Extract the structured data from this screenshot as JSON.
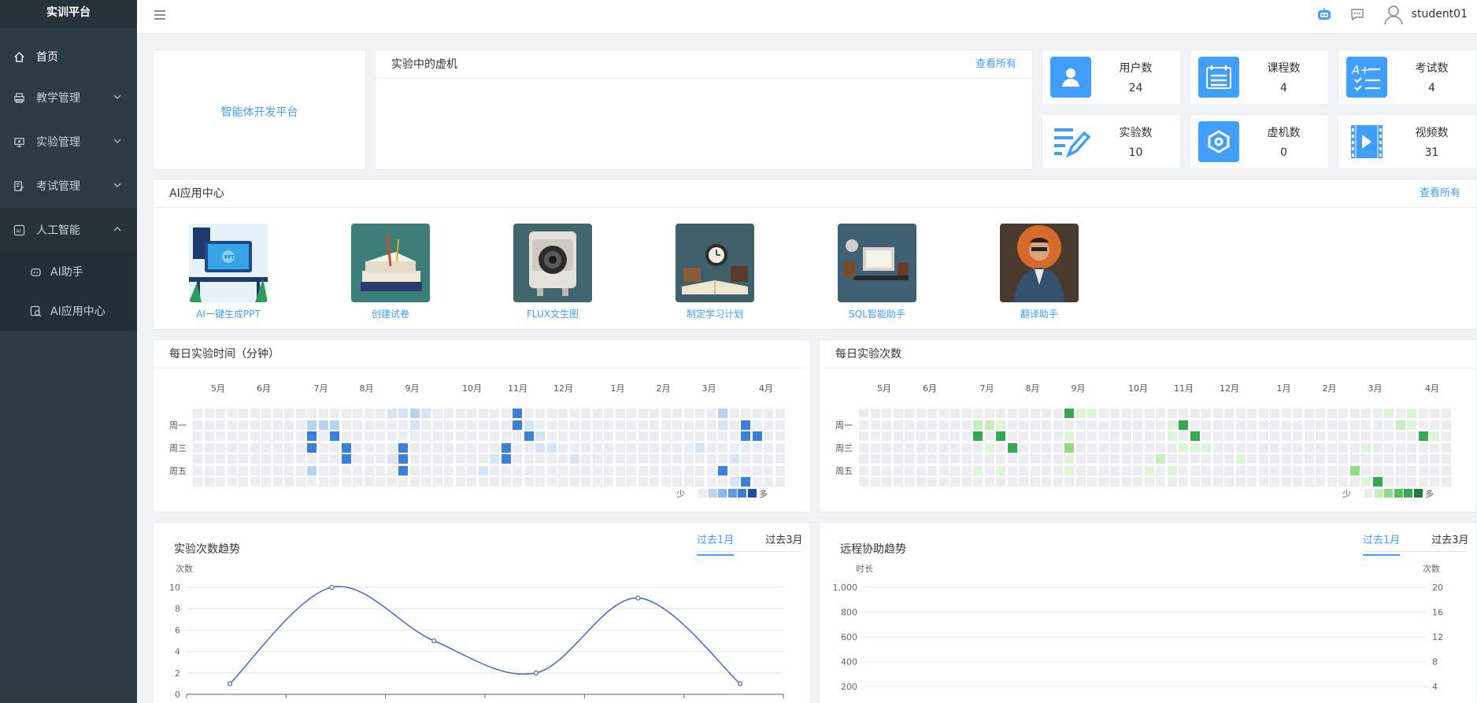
{
  "sidebar": {
    "logo": "实训平台",
    "items": [
      {
        "label": "首页"
      },
      {
        "label": "教学管理"
      },
      {
        "label": "实验管理"
      },
      {
        "label": "考试管理"
      },
      {
        "label": "人工智能"
      }
    ],
    "sub_items": [
      {
        "label": "AI助手"
      },
      {
        "label": "AI应用中心"
      }
    ]
  },
  "header": {
    "username": "student01"
  },
  "brand": {
    "link": "智能体开发平台"
  },
  "vm_panel": {
    "title": "实验中的虚机",
    "link": "查看所有"
  },
  "stats": [
    {
      "label": "用户数",
      "value": "24",
      "icon": "user-icon"
    },
    {
      "label": "课程数",
      "value": "4",
      "icon": "calendar-list-icon"
    },
    {
      "label": "考试数",
      "value": "4",
      "icon": "grade-checklist-icon"
    },
    {
      "label": "实验数",
      "value": "10",
      "icon": "edit-document-icon"
    },
    {
      "label": "虚机数",
      "value": "0",
      "icon": "hexagon-icon"
    },
    {
      "label": "视频数",
      "value": "31",
      "icon": "video-film-icon"
    }
  ],
  "ai_center": {
    "title": "AI应用中心",
    "link": "查看所有",
    "apps": [
      {
        "label": "AI一键生成PPT"
      },
      {
        "label": "创建试卷"
      },
      {
        "label": "FLUX文生图"
      },
      {
        "label": "制定学习计划"
      },
      {
        "label": "SQL智能助手"
      },
      {
        "label": "翻译助手"
      }
    ]
  },
  "heatmap_time": {
    "title": "每日实验时间（分钟）",
    "months": [
      "5月",
      "6月",
      "7月",
      "8月",
      "9月",
      "10月",
      "11月",
      "12月",
      "1月",
      "2月",
      "3月",
      "4月"
    ],
    "days": [
      "周一",
      "周三",
      "周五"
    ],
    "legend_less": "少",
    "legend_more": "多",
    "colors": [
      "#ebedf0",
      "#d6e4f7",
      "#b8d3f2",
      "#8ab8ec",
      "#5b9be2",
      "#3a7fd9",
      "#1f4e9e"
    ]
  },
  "heatmap_count": {
    "title": "每日实验次数",
    "months": [
      "5月",
      "6月",
      "7月",
      "8月",
      "9月",
      "10月",
      "11月",
      "12月",
      "1月",
      "2月",
      "3月",
      "4月"
    ],
    "days": [
      "周一",
      "周三",
      "周五"
    ],
    "legend_less": "少",
    "legend_more": "多",
    "colors": [
      "#ebedf0",
      "#dff5d9",
      "#c6ecbd",
      "#8fdc84",
      "#52c15d",
      "#34a853",
      "#1f7a3a"
    ]
  },
  "trend_count": {
    "title": "实验次数趋势",
    "tabs": [
      "过去1月",
      "过去3月"
    ],
    "ylabel": "次数",
    "yticks": [
      "10",
      "8",
      "6",
      "4",
      "2",
      "0"
    ]
  },
  "trend_remote": {
    "title": "远程协助趋势",
    "tabs": [
      "过去1月",
      "过去3月"
    ],
    "ylabel_left": "时长",
    "ylabel_right": "次数",
    "yticks_left": [
      "1,000",
      "800",
      "600",
      "400",
      "200"
    ],
    "yticks_right": [
      "20",
      "16",
      "12",
      "8",
      "4"
    ]
  },
  "chart_data": {
    "type": "line",
    "title": "实验次数趋势",
    "ylabel": "次数",
    "ylim": [
      0,
      10
    ],
    "x": [
      0,
      1,
      2,
      3,
      4,
      5
    ],
    "series": [
      {
        "values": [
          1,
          10,
          5,
          2,
          9,
          1
        ]
      }
    ]
  }
}
